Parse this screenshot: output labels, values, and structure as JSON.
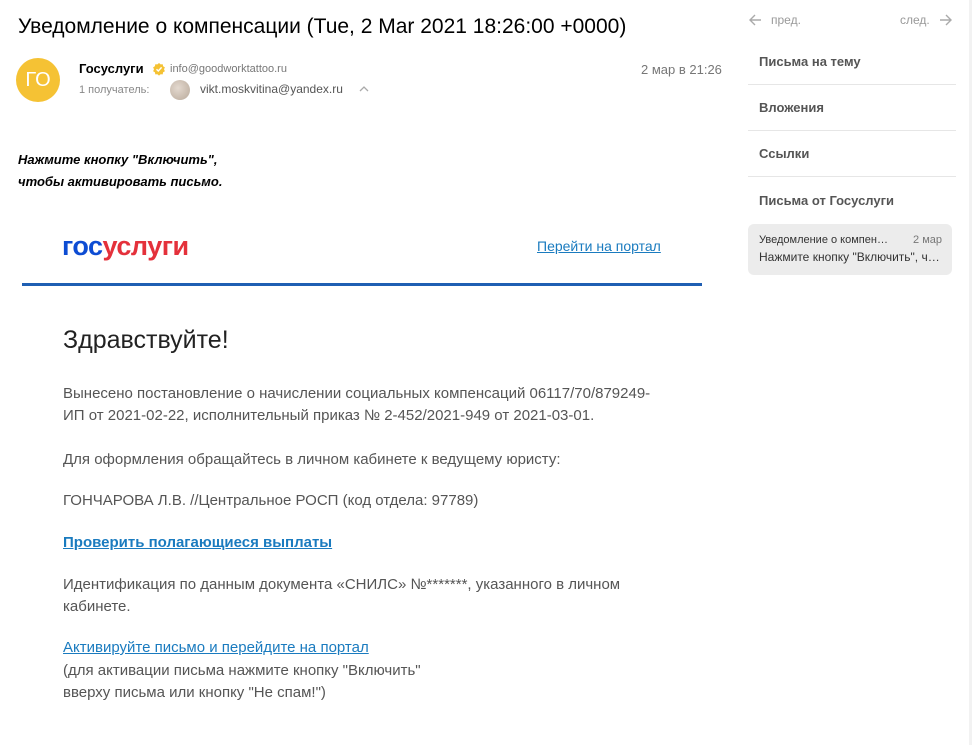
{
  "message": {
    "subject": "Уведомление о компенсации (Tue, 2 Mar 2021 18:26:00 +0000)",
    "avatar_initials": "ГО",
    "sender_name": "Госуслуги",
    "sender_email": "info@goodworktattoo.ru",
    "recipients_label": "1 получатель:",
    "recipient_email": "vikt.moskvitina@yandex.ru",
    "date": "2 мар в 21:26"
  },
  "notice": {
    "line1": "Нажмите кнопку \"Включить\",",
    "line2": "чтобы активировать письмо."
  },
  "body": {
    "logo_part1": "гос",
    "logo_part2": "услуги",
    "portal_link": "Перейти на портал",
    "greeting": "Здравствуйте!",
    "p1_line1": "Вынесено постановление о начислении социальных компенсаций 06117/70/879249-",
    "p1_line2": "ИП от 2021-02-22, исполнительный приказ № 2-452/2021-949 от 2021-03-01.",
    "p2": "Для оформления обращайтесь в личном кабинете к ведущему юристу:",
    "p3": "ГОНЧАРОВА Л.В. //Центральное РОСП (код отдела: 97789)",
    "check_link": "Проверить полагающиеся выплаты",
    "p4_line1": "Идентификация по данным документа «СНИЛС» №*******, указанного в личном",
    "p4_line2": "кабинете.",
    "activate_link": "Активируйте письмо и перейдите на портал",
    "activate_note1": "(для активации письма нажмите кнопку \"Включить\"",
    "activate_note2": "вверху письма или кнопку \"Не спам!\")"
  },
  "sidebar": {
    "prev_label": "пред.",
    "next_label": "след.",
    "items": [
      "Письма на тему",
      "Вложения",
      "Ссылки",
      "Письма от Госуслуги"
    ],
    "thread": {
      "subject": "Уведомление о компенсации",
      "date": "2 мар",
      "snippet": "Нажмите кнопку \"Включить\", чтобы"
    }
  },
  "colors": {
    "avatar": "#f5c234",
    "logo_blue": "#0d4cd3",
    "logo_red": "#e4313b",
    "link": "#1a7bbf",
    "rule": "#1f5fb3"
  },
  "icons": [
    "verified-badge-icon",
    "chevron-up-icon",
    "arrow-left-icon",
    "arrow-right-icon"
  ]
}
